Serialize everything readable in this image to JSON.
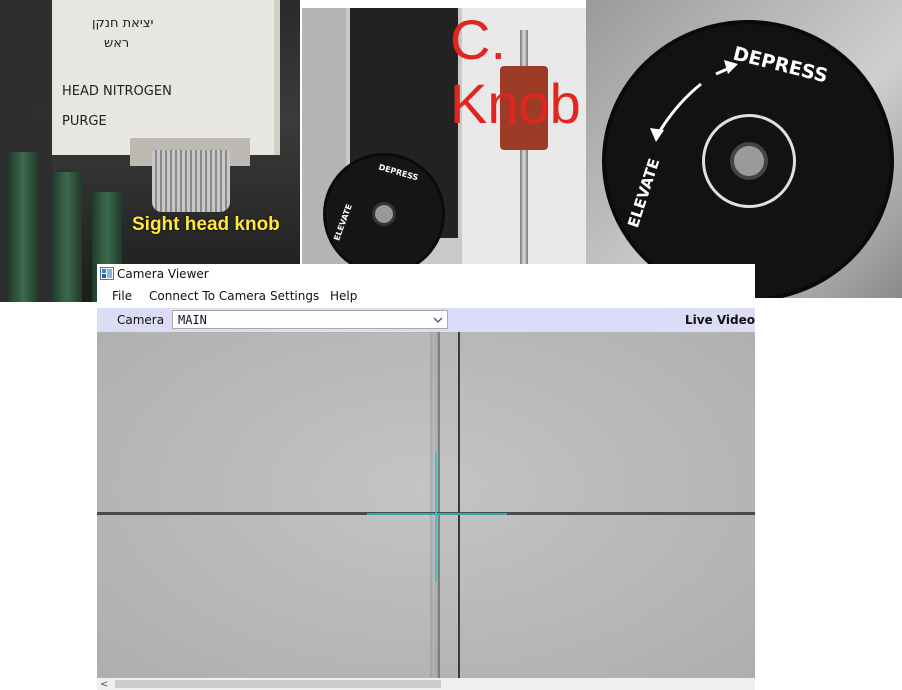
{
  "photos": {
    "left": {
      "box_hebrew_line1": "יציאת חנקן",
      "box_hebrew_line2": "ראש",
      "box_line3": "HEAD NITROGEN",
      "box_line4": "PURGE",
      "box_code": "J2",
      "caption": "Sight head knob"
    },
    "middle": {
      "caption": "C. Knob",
      "knob_text_top": "DEPRESS",
      "knob_text_side": "ELEVATE"
    },
    "right": {
      "knob_text_top": "DEPRESS",
      "knob_text_side": "ELEVATE"
    }
  },
  "window": {
    "title": "Camera Viewer",
    "menu": [
      "File",
      "Connect To Camera",
      "Settings",
      "Help"
    ],
    "toolbar": {
      "camera_label": "Camera",
      "camera_value": "MAIN",
      "status": "Live Video"
    },
    "scroll_left_glyph": "<"
  },
  "colors": {
    "toolbar_bg": "#dcdcf7",
    "crosshair": "#2fc6c6",
    "caption_yellow": "#ffe83a",
    "caption_red": "#e0261f"
  }
}
